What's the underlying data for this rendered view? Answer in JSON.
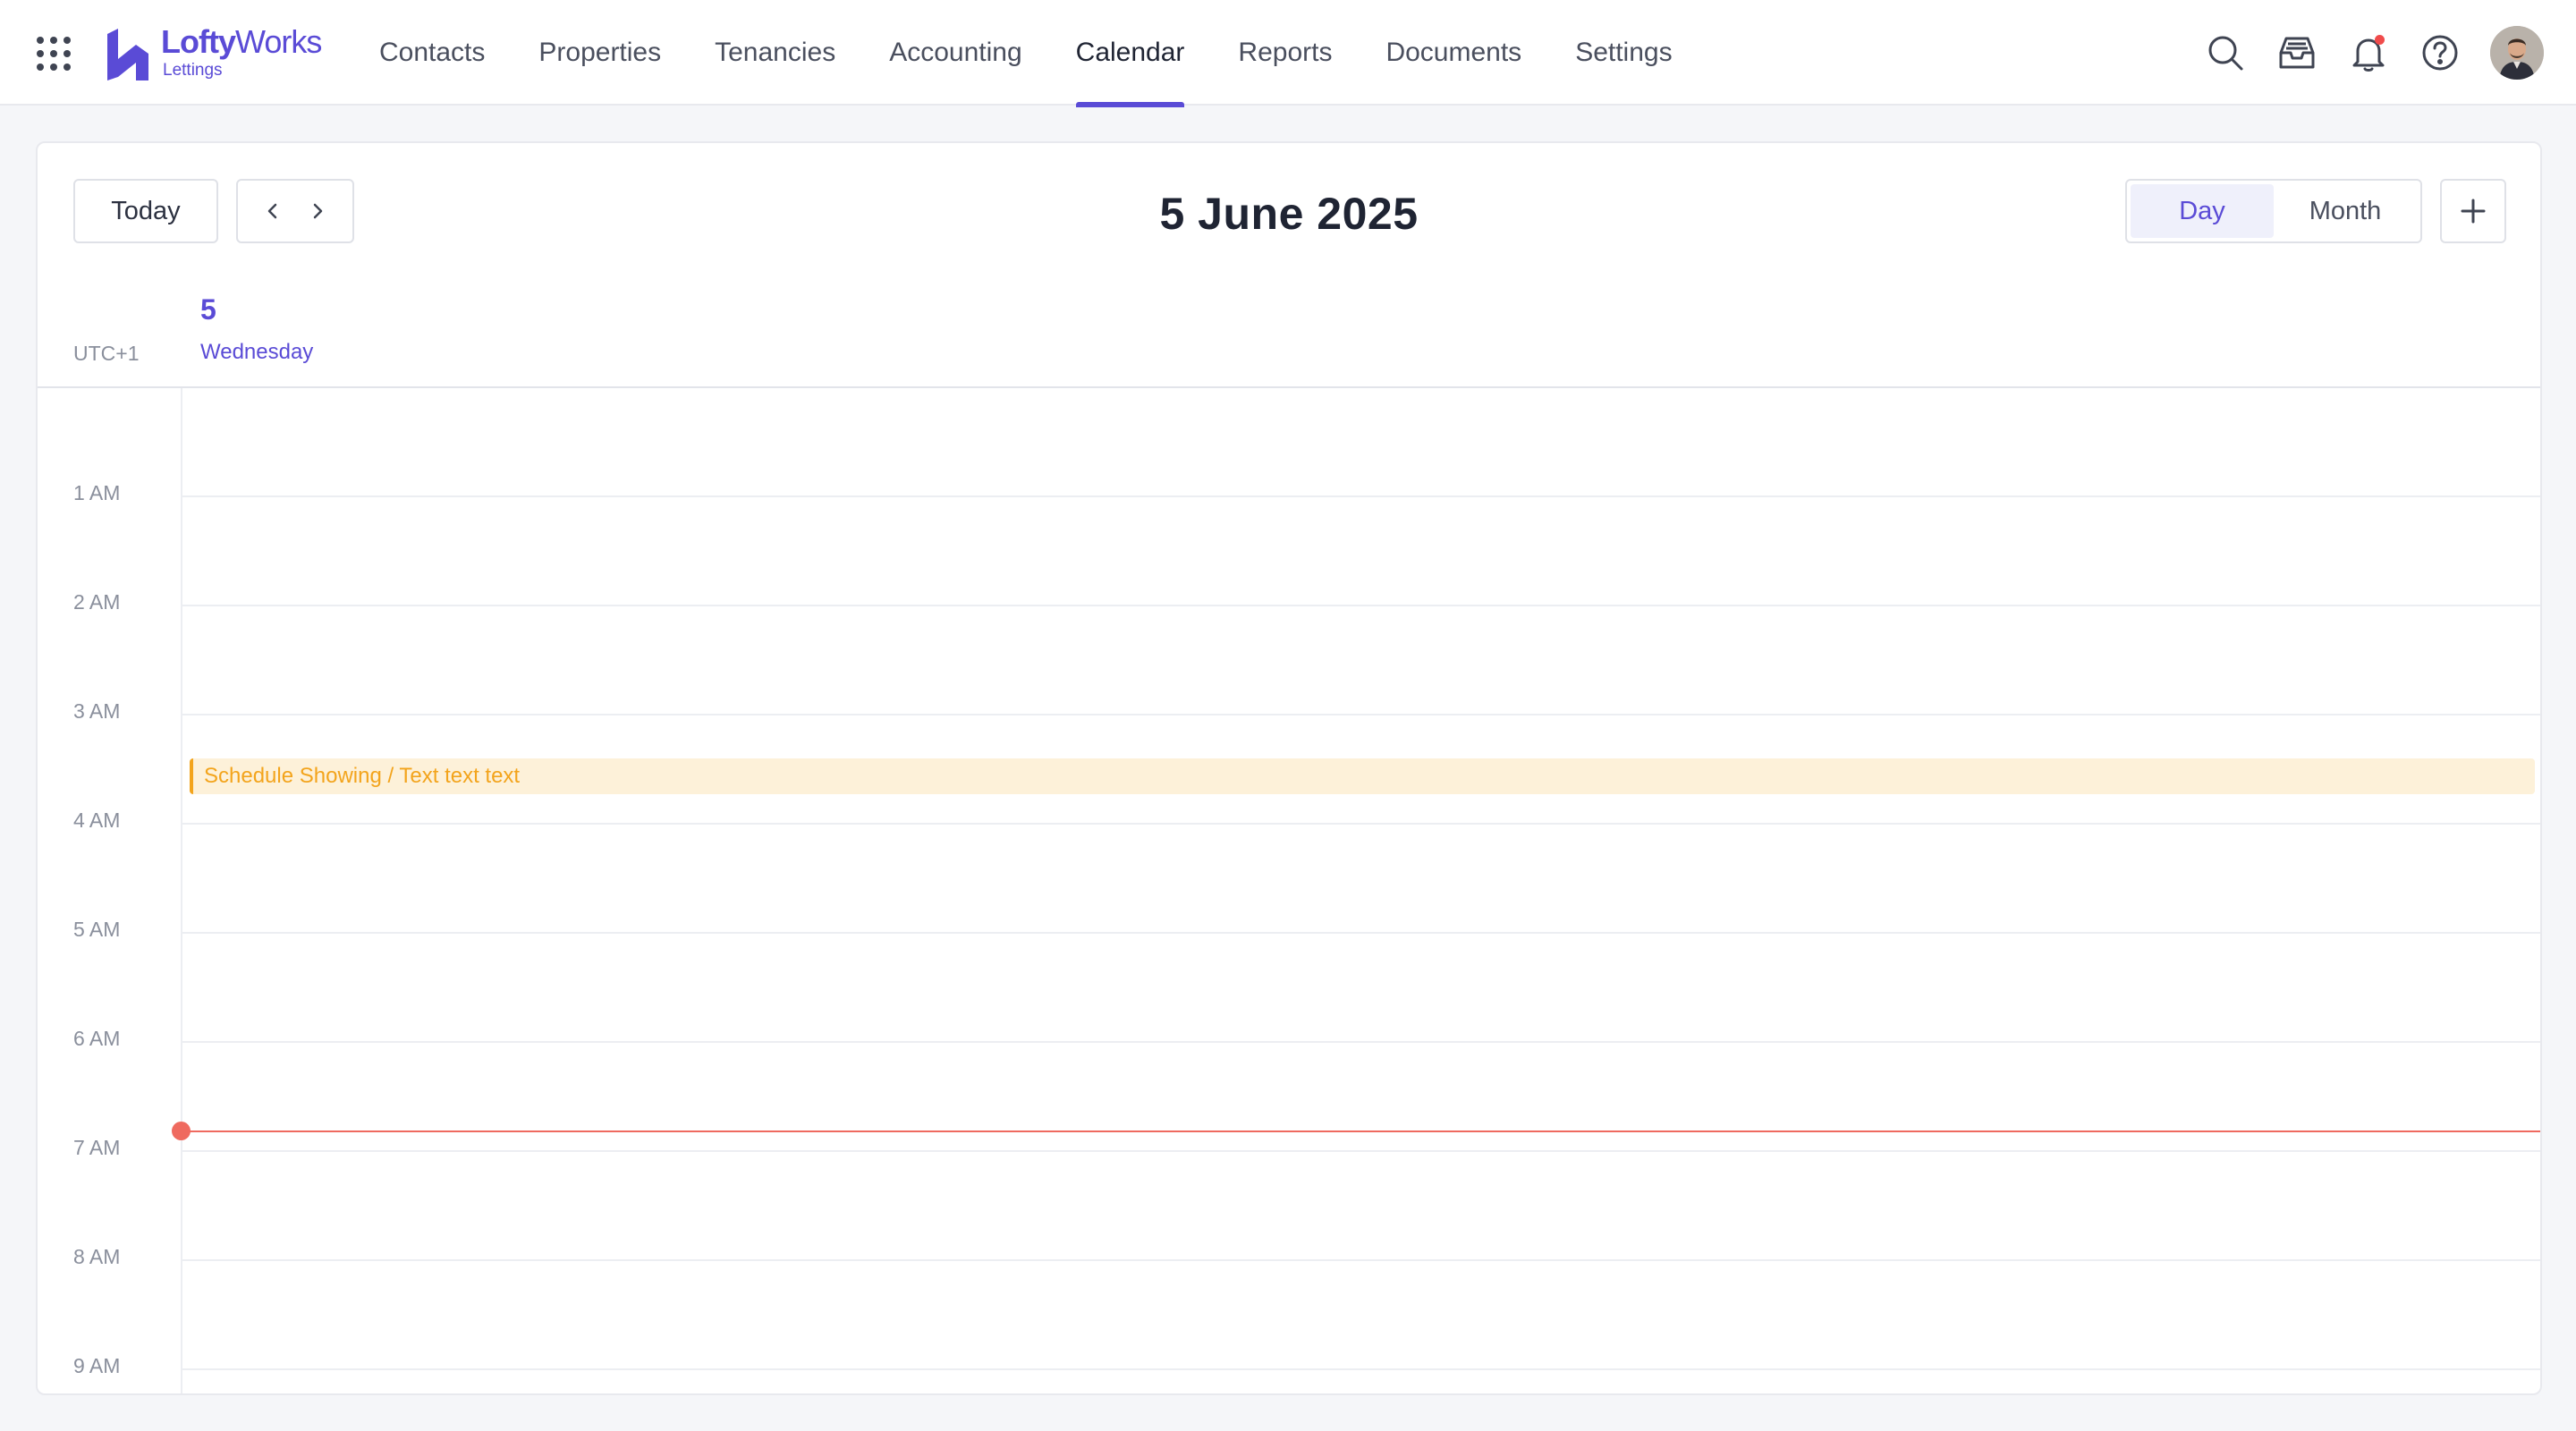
{
  "brand": {
    "name_bold": "Lofty",
    "name_thin": "Works",
    "subtitle": "Lettings",
    "color": "#5a4bd6"
  },
  "nav": {
    "items": [
      {
        "label": "Contacts"
      },
      {
        "label": "Properties"
      },
      {
        "label": "Tenancies"
      },
      {
        "label": "Accounting"
      },
      {
        "label": "Calendar",
        "active": true
      },
      {
        "label": "Reports"
      },
      {
        "label": "Documents"
      },
      {
        "label": "Settings"
      }
    ]
  },
  "top_icons": [
    "search-icon",
    "inbox-icon",
    "bell-icon",
    "help-icon",
    "avatar"
  ],
  "toolbar": {
    "today_label": "Today",
    "title": "5 June 2025",
    "views": [
      {
        "label": "Day",
        "active": true
      },
      {
        "label": "Month"
      }
    ]
  },
  "day": {
    "timezone": "UTC+1",
    "number": "5",
    "weekday": "Wednesday"
  },
  "hours": [
    "1 AM",
    "2 AM",
    "3 AM",
    "4 AM",
    "5 AM",
    "6 AM",
    "7 AM",
    "8 AM",
    "9 AM"
  ],
  "events": [
    {
      "label": "Schedule Showing / Text text text",
      "color": "#f3a41c",
      "background": "#fdf1d9"
    }
  ],
  "colors": {
    "accent": "#5a4bd6",
    "now_indicator": "#ef6a5f",
    "notification": "#f04b4b"
  }
}
